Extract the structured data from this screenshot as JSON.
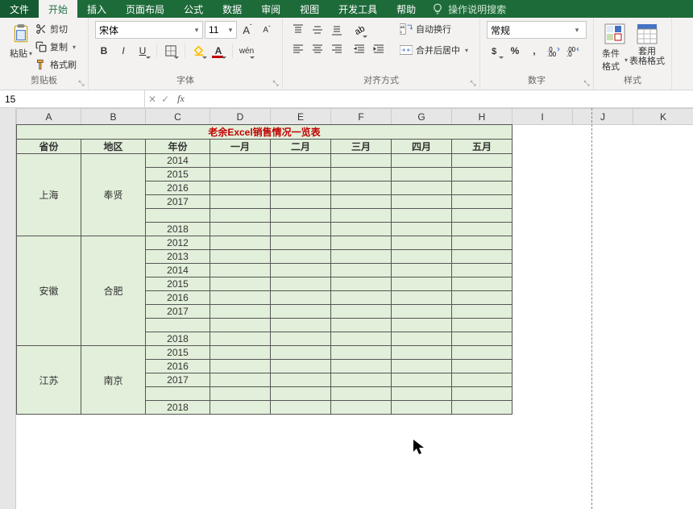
{
  "tabs": {
    "file": "文件",
    "home": "开始",
    "insert": "插入",
    "layout": "页面布局",
    "formulas": "公式",
    "data": "数据",
    "review": "审阅",
    "view": "视图",
    "dev": "开发工具",
    "help": "帮助",
    "tellme": "操作说明搜索"
  },
  "ribbon": {
    "clipboard": {
      "label": "剪贴板",
      "paste": "粘贴",
      "cut": "剪切",
      "copy": "复制",
      "painter": "格式刷"
    },
    "font": {
      "label": "字体",
      "name": "宋体",
      "size": "11"
    },
    "align": {
      "label": "对齐方式",
      "wrap": "自动换行",
      "merge": "合并后居中"
    },
    "number": {
      "label": "数字",
      "format": "常规"
    },
    "styles": {
      "label": "样式",
      "cond": "条件格式",
      "table": "套用\n表格格式"
    }
  },
  "namebox": "15",
  "cols": [
    "A",
    "B",
    "C",
    "D",
    "E",
    "F",
    "G",
    "H",
    "I",
    "J",
    "K"
  ],
  "title": "老余Excel销售情况一览表",
  "headers": [
    "省份",
    "地区",
    "年份",
    "一月",
    "二月",
    "三月",
    "四月",
    "五月"
  ],
  "blocks": [
    {
      "prov": "上海",
      "area": "奉贤",
      "years": [
        "2014",
        "2015",
        "2016",
        "2017",
        "",
        "2018"
      ]
    },
    {
      "prov": "安徽",
      "area": "合肥",
      "years": [
        "2012",
        "2013",
        "2014",
        "2015",
        "2016",
        "2017",
        "",
        "2018"
      ]
    },
    {
      "prov": "江苏",
      "area": "南京",
      "years": [
        "2015",
        "2016",
        "2017",
        "",
        "2018"
      ]
    }
  ],
  "chart_data": {
    "type": "table",
    "title": "老余Excel销售情况一览表",
    "columns": [
      "省份",
      "地区",
      "年份",
      "一月",
      "二月",
      "三月",
      "四月",
      "五月"
    ],
    "rows": [
      [
        "上海",
        "奉贤",
        "2014",
        "",
        "",
        "",
        "",
        ""
      ],
      [
        "上海",
        "奉贤",
        "2015",
        "",
        "",
        "",
        "",
        ""
      ],
      [
        "上海",
        "奉贤",
        "2016",
        "",
        "",
        "",
        "",
        ""
      ],
      [
        "上海",
        "奉贤",
        "2017",
        "",
        "",
        "",
        "",
        ""
      ],
      [
        "上海",
        "奉贤",
        "",
        "",
        "",
        "",
        "",
        ""
      ],
      [
        "上海",
        "奉贤",
        "2018",
        "",
        "",
        "",
        "",
        ""
      ],
      [
        "安徽",
        "合肥",
        "2012",
        "",
        "",
        "",
        "",
        ""
      ],
      [
        "安徽",
        "合肥",
        "2013",
        "",
        "",
        "",
        "",
        ""
      ],
      [
        "安徽",
        "合肥",
        "2014",
        "",
        "",
        "",
        "",
        ""
      ],
      [
        "安徽",
        "合肥",
        "2015",
        "",
        "",
        "",
        "",
        ""
      ],
      [
        "安徽",
        "合肥",
        "2016",
        "",
        "",
        "",
        "",
        ""
      ],
      [
        "安徽",
        "合肥",
        "2017",
        "",
        "",
        "",
        "",
        ""
      ],
      [
        "安徽",
        "合肥",
        "",
        "",
        "",
        "",
        "",
        ""
      ],
      [
        "安徽",
        "合肥",
        "2018",
        "",
        "",
        "",
        "",
        ""
      ],
      [
        "江苏",
        "南京",
        "2015",
        "",
        "",
        "",
        "",
        ""
      ],
      [
        "江苏",
        "南京",
        "2016",
        "",
        "",
        "",
        "",
        ""
      ],
      [
        "江苏",
        "南京",
        "2017",
        "",
        "",
        "",
        "",
        ""
      ],
      [
        "江苏",
        "南京",
        "",
        "",
        "",
        "",
        "",
        ""
      ],
      [
        "江苏",
        "南京",
        "2018",
        "",
        "",
        "",
        "",
        ""
      ]
    ]
  }
}
